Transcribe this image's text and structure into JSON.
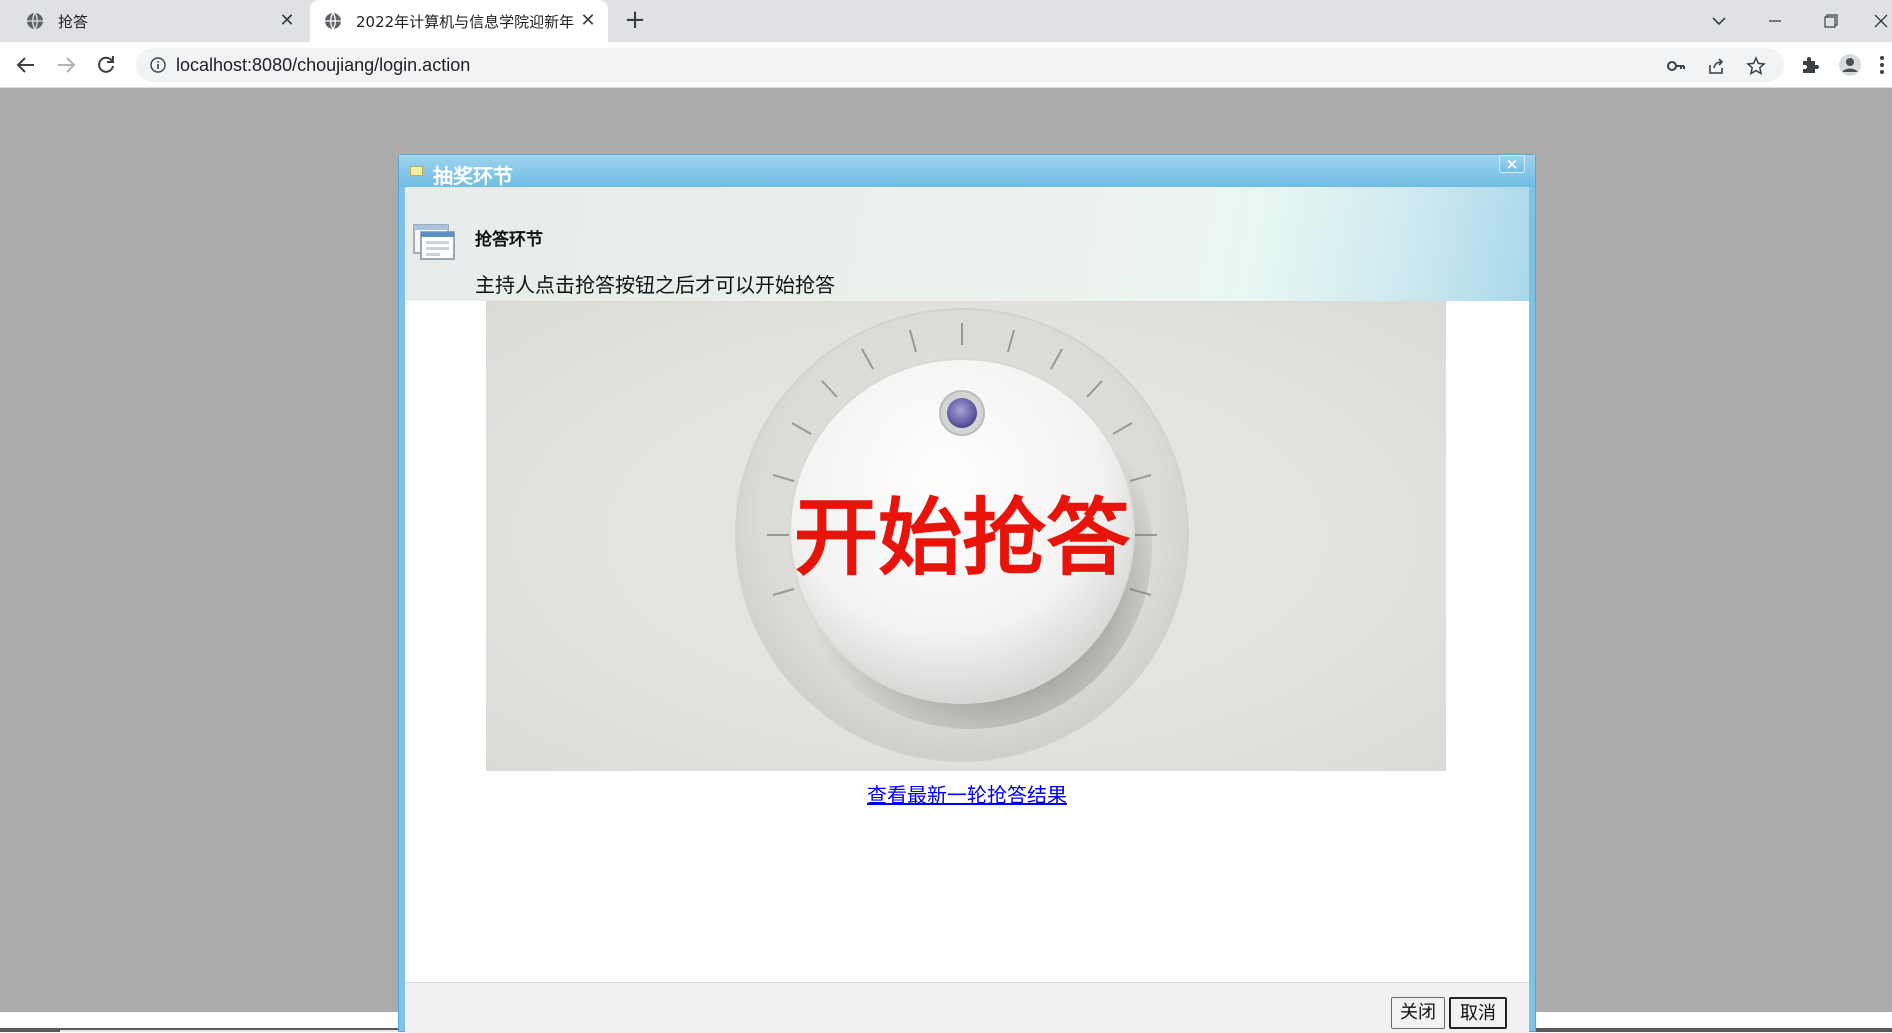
{
  "browser": {
    "tabs": [
      {
        "title": "抢答",
        "active": false
      },
      {
        "title": "2022年计算机与信息学院迎新年",
        "active": true
      }
    ],
    "url": "localhost:8080/choujiang/login.action",
    "icons": {
      "favicon": "globe-icon",
      "back": "arrow-left-icon",
      "forward": "arrow-right-icon",
      "reload": "reload-icon",
      "info": "info-icon",
      "key": "key-icon",
      "share": "share-icon",
      "star": "star-icon",
      "extensions": "puzzle-icon",
      "profile": "profile-icon",
      "menu": "kebab-menu-icon"
    }
  },
  "dialog": {
    "title": "抽奖环节",
    "close_glyph": "×",
    "header_title": "抢答环节",
    "header_desc": "主持人点击抢答按钮之后才可以开始抢答",
    "start_button_label": "开始抢答",
    "result_link": "查看最新一轮抢答结果",
    "footer": {
      "close_label": "关闭",
      "cancel_label": "取消"
    }
  },
  "colors": {
    "dialog_border": "#7dc3e6",
    "start_text": "#e8140c",
    "page_overlay": "#ababab",
    "link": "#0000ee"
  }
}
